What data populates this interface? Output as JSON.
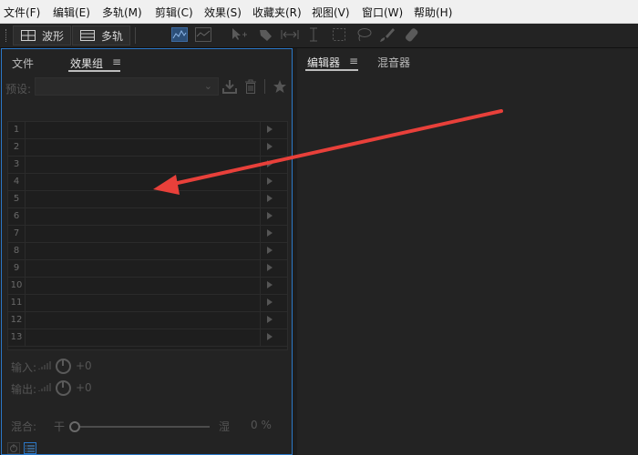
{
  "menu": [
    {
      "label": "文件(F)"
    },
    {
      "label": "编辑(E)"
    },
    {
      "label": "多轨(M)"
    },
    {
      "label": "剪辑(C)"
    },
    {
      "label": "效果(S)"
    },
    {
      "label": "收藏夹(R)"
    },
    {
      "label": "视图(V)"
    },
    {
      "label": "窗口(W)"
    },
    {
      "label": "帮助(H)"
    }
  ],
  "toolbar": {
    "waveform_label": "波形",
    "multitrack_label": "多轨",
    "tools": [
      "spectral-frequency-icon",
      "spectral-pitch-icon",
      "move-tool-icon",
      "razor-tool-icon",
      "slip-tool-icon",
      "time-selection-icon",
      "marquee-icon",
      "lasso-icon",
      "brush-icon",
      "spot-healing-icon"
    ]
  },
  "left_panel": {
    "tabs": [
      {
        "label": "文件"
      },
      {
        "label": "效果组"
      }
    ],
    "active_tab": "效果组",
    "preset_label": "预设:",
    "preset_value": "",
    "slots": [
      "1",
      "2",
      "3",
      "4",
      "5",
      "6",
      "7",
      "8",
      "9",
      "10",
      "11",
      "12",
      "13"
    ],
    "input_label": "输入:",
    "input_value": "+0",
    "output_label": "输出:",
    "output_value": "+0",
    "mix_label": "混合:",
    "mix_dry": "干",
    "mix_wet": "湿",
    "mix_value": "0 %"
  },
  "right_panel": {
    "tabs": [
      {
        "label": "编辑器"
      },
      {
        "label": "混音器"
      }
    ],
    "active_tab": "编辑器"
  },
  "annotation": {
    "type": "arrow",
    "color": "#e8403a"
  },
  "colors": {
    "accent": "#2b78c8",
    "background": "#1d1d1d",
    "panel": "#232323"
  }
}
